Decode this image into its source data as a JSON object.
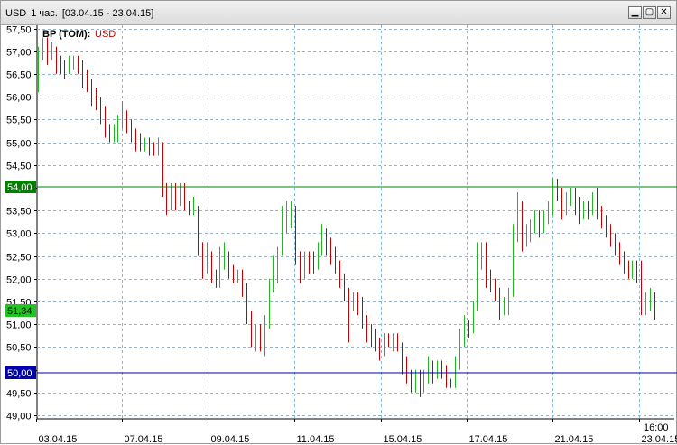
{
  "window": {
    "title_parts": [
      "USD",
      "1 час.",
      "[03.04.15 - 23.04.15]"
    ],
    "buttons": [
      {
        "name": "minimize-button",
        "icon": "minimize-icon",
        "glyph": "▁"
      },
      {
        "name": "restore-button",
        "icon": "restore-icon",
        "glyph": "▢"
      },
      {
        "name": "close-button",
        "icon": "close-icon",
        "glyph": "✕"
      }
    ]
  },
  "legend": {
    "instrument": "BP (TOM):",
    "currency": "USD"
  },
  "price_labels": {
    "green_line": "54,00",
    "current": "51,34",
    "blue_line": "50,00"
  },
  "colors": {
    "up": "#22b622",
    "down": "#c40000",
    "grid": "#8ab4d8",
    "green_line": "#008000",
    "blue_line": "#0000aa",
    "current_bg": "#22c422",
    "blue_bg": "#0000aa"
  },
  "time_label": "16:00",
  "chart_data": {
    "type": "candlestick-bars",
    "title": "BP (TOM): USD",
    "ylim": [
      49.0,
      57.5
    ],
    "y_ticks": [
      "57,50",
      "57,00",
      "56,50",
      "56,00",
      "55,50",
      "55,00",
      "54,50",
      "54,00",
      "53,50",
      "53,00",
      "52,50",
      "52,00",
      "51,50",
      "51,00",
      "50,50",
      "50,00",
      "49,50",
      "49,00"
    ],
    "x_ticks": [
      "03.04.15",
      "07.04.15",
      "09.04.15",
      "11.04.15",
      "15.04.15",
      "17.04.15",
      "21.04.15",
      "23.04.15"
    ],
    "horizontal_lines": [
      {
        "value": 54.0,
        "color": "green"
      },
      {
        "value": 50.0,
        "color": "blue"
      }
    ],
    "last_value": 51.34,
    "bars": [
      {
        "o": 56.2,
        "c": 56.9,
        "h": 57.1,
        "l": 56.1,
        "up": true
      },
      {
        "o": 56.9,
        "c": 57.1,
        "h": 57.3,
        "l": 56.8,
        "up": true
      },
      {
        "o": 57.1,
        "c": 56.9,
        "h": 57.3,
        "l": 56.7,
        "up": false
      },
      {
        "o": 56.9,
        "c": 57.0,
        "h": 57.2,
        "l": 56.8,
        "up": true
      },
      {
        "o": 57.0,
        "c": 56.8,
        "h": 57.1,
        "l": 56.5,
        "up": false
      },
      {
        "o": 56.8,
        "c": 56.7,
        "h": 56.9,
        "l": 56.5,
        "up": false
      },
      {
        "o": 56.7,
        "c": 56.6,
        "h": 56.8,
        "l": 56.4,
        "up": false
      },
      {
        "o": 56.6,
        "c": 56.7,
        "h": 56.9,
        "l": 56.5,
        "up": true
      },
      {
        "o": 56.7,
        "c": 56.8,
        "h": 56.9,
        "l": 56.6,
        "up": true
      },
      {
        "o": 56.8,
        "c": 56.7,
        "h": 56.9,
        "l": 56.5,
        "up": false
      },
      {
        "o": 56.7,
        "c": 56.5,
        "h": 56.8,
        "l": 56.2,
        "up": false
      },
      {
        "o": 56.5,
        "c": 56.3,
        "h": 56.6,
        "l": 56.1,
        "up": false
      },
      {
        "o": 56.3,
        "c": 56.1,
        "h": 56.4,
        "l": 55.8,
        "up": false
      },
      {
        "o": 56.1,
        "c": 55.9,
        "h": 56.2,
        "l": 55.7,
        "up": false
      },
      {
        "o": 55.9,
        "c": 55.6,
        "h": 56.0,
        "l": 55.4,
        "up": false
      },
      {
        "o": 55.6,
        "c": 55.2,
        "h": 55.8,
        "l": 55.1,
        "up": false
      },
      {
        "o": 55.2,
        "c": 55.1,
        "h": 55.4,
        "l": 55.0,
        "up": false
      },
      {
        "o": 55.1,
        "c": 55.2,
        "h": 55.4,
        "l": 55.0,
        "up": true
      },
      {
        "o": 55.2,
        "c": 55.4,
        "h": 55.6,
        "l": 55.0,
        "up": true
      },
      {
        "o": 55.4,
        "c": 55.6,
        "h": 55.9,
        "l": 55.3,
        "up": true
      },
      {
        "o": 55.6,
        "c": 55.4,
        "h": 55.7,
        "l": 55.2,
        "up": false
      },
      {
        "o": 55.4,
        "c": 55.2,
        "h": 55.5,
        "l": 55.0,
        "up": false
      },
      {
        "o": 55.2,
        "c": 55.0,
        "h": 55.3,
        "l": 54.8,
        "up": false
      },
      {
        "o": 55.0,
        "c": 54.9,
        "h": 55.2,
        "l": 54.8,
        "up": false
      },
      {
        "o": 54.9,
        "c": 55.0,
        "h": 55.1,
        "l": 54.8,
        "up": true
      },
      {
        "o": 55.0,
        "c": 54.9,
        "h": 55.1,
        "l": 54.7,
        "up": false
      },
      {
        "o": 54.9,
        "c": 54.8,
        "h": 55.0,
        "l": 54.7,
        "up": false
      },
      {
        "o": 54.8,
        "c": 54.9,
        "h": 55.1,
        "l": 54.7,
        "up": true
      },
      {
        "o": 54.9,
        "c": 54.0,
        "h": 55.0,
        "l": 53.8,
        "up": false
      },
      {
        "o": 54.0,
        "c": 53.6,
        "h": 54.1,
        "l": 53.4,
        "up": false
      },
      {
        "o": 53.6,
        "c": 54.0,
        "h": 54.1,
        "l": 53.5,
        "up": true
      },
      {
        "o": 54.0,
        "c": 53.7,
        "h": 54.1,
        "l": 53.5,
        "up": false
      },
      {
        "o": 53.7,
        "c": 53.9,
        "h": 54.1,
        "l": 53.6,
        "up": true
      },
      {
        "o": 53.9,
        "c": 53.6,
        "h": 54.1,
        "l": 53.5,
        "up": false
      },
      {
        "o": 53.6,
        "c": 53.5,
        "h": 53.7,
        "l": 53.4,
        "up": false
      },
      {
        "o": 53.5,
        "c": 53.6,
        "h": 53.8,
        "l": 53.4,
        "up": true
      },
      {
        "o": 53.6,
        "c": 52.7,
        "h": 53.6,
        "l": 52.5,
        "up": false
      },
      {
        "o": 52.7,
        "c": 52.2,
        "h": 52.8,
        "l": 52.0,
        "up": false
      },
      {
        "o": 52.2,
        "c": 52.4,
        "h": 52.8,
        "l": 52.1,
        "up": true
      },
      {
        "o": 52.4,
        "c": 52.1,
        "h": 52.6,
        "l": 51.9,
        "up": false
      },
      {
        "o": 52.1,
        "c": 51.9,
        "h": 52.2,
        "l": 51.8,
        "up": false
      },
      {
        "o": 51.9,
        "c": 52.3,
        "h": 52.7,
        "l": 51.8,
        "up": true
      },
      {
        "o": 52.3,
        "c": 52.5,
        "h": 52.8,
        "l": 52.2,
        "up": true
      },
      {
        "o": 52.5,
        "c": 52.2,
        "h": 52.6,
        "l": 52.0,
        "up": false
      },
      {
        "o": 52.2,
        "c": 52.0,
        "h": 52.3,
        "l": 51.9,
        "up": false
      },
      {
        "o": 52.0,
        "c": 52.1,
        "h": 52.2,
        "l": 51.9,
        "up": true
      },
      {
        "o": 52.1,
        "c": 51.8,
        "h": 52.2,
        "l": 51.6,
        "up": false
      },
      {
        "o": 51.8,
        "c": 51.2,
        "h": 51.9,
        "l": 51.0,
        "up": false
      },
      {
        "o": 51.2,
        "c": 50.6,
        "h": 51.3,
        "l": 50.5,
        "up": false
      },
      {
        "o": 50.6,
        "c": 50.8,
        "h": 51.0,
        "l": 50.4,
        "up": true
      },
      {
        "o": 50.8,
        "c": 50.5,
        "h": 51.0,
        "l": 50.4,
        "up": false
      },
      {
        "o": 50.5,
        "c": 51.0,
        "h": 51.2,
        "l": 50.3,
        "up": true
      },
      {
        "o": 51.0,
        "c": 51.8,
        "h": 52.0,
        "l": 50.9,
        "up": true
      },
      {
        "o": 51.8,
        "c": 52.2,
        "h": 52.5,
        "l": 51.7,
        "up": true
      },
      {
        "o": 52.2,
        "c": 52.6,
        "h": 52.7,
        "l": 51.9,
        "up": true
      },
      {
        "o": 52.6,
        "c": 53.2,
        "h": 53.6,
        "l": 52.5,
        "up": true
      },
      {
        "o": 53.2,
        "c": 53.4,
        "h": 53.7,
        "l": 53.0,
        "up": true
      },
      {
        "o": 53.4,
        "c": 53.6,
        "h": 53.7,
        "l": 53.1,
        "up": true
      },
      {
        "o": 53.6,
        "c": 52.5,
        "h": 53.6,
        "l": 52.3,
        "up": false
      },
      {
        "o": 52.5,
        "c": 52.1,
        "h": 52.6,
        "l": 51.9,
        "up": false
      },
      {
        "o": 52.1,
        "c": 52.5,
        "h": 52.6,
        "l": 52.0,
        "up": true
      },
      {
        "o": 52.5,
        "c": 52.4,
        "h": 52.6,
        "l": 52.1,
        "up": false
      },
      {
        "o": 52.4,
        "c": 52.3,
        "h": 52.6,
        "l": 52.1,
        "up": false
      },
      {
        "o": 52.3,
        "c": 52.6,
        "h": 52.8,
        "l": 52.2,
        "up": true
      },
      {
        "o": 52.6,
        "c": 53.0,
        "h": 53.2,
        "l": 52.5,
        "up": true
      },
      {
        "o": 53.0,
        "c": 52.7,
        "h": 53.1,
        "l": 52.5,
        "up": false
      },
      {
        "o": 52.7,
        "c": 52.5,
        "h": 52.9,
        "l": 52.3,
        "up": false
      },
      {
        "o": 52.5,
        "c": 52.3,
        "h": 52.7,
        "l": 52.1,
        "up": false
      },
      {
        "o": 52.3,
        "c": 52.0,
        "h": 52.4,
        "l": 51.8,
        "up": false
      },
      {
        "o": 52.0,
        "c": 51.7,
        "h": 52.1,
        "l": 51.5,
        "up": false
      },
      {
        "o": 51.7,
        "c": 51.5,
        "h": 51.8,
        "l": 50.6,
        "up": false
      },
      {
        "o": 51.5,
        "c": 51.6,
        "h": 51.7,
        "l": 51.3,
        "up": true
      },
      {
        "o": 51.6,
        "c": 51.4,
        "h": 51.7,
        "l": 51.2,
        "up": false
      },
      {
        "o": 51.4,
        "c": 51.1,
        "h": 51.6,
        "l": 50.9,
        "up": false
      },
      {
        "o": 51.1,
        "c": 50.8,
        "h": 51.2,
        "l": 50.6,
        "up": false
      },
      {
        "o": 50.8,
        "c": 50.7,
        "h": 51.0,
        "l": 50.5,
        "up": false
      },
      {
        "o": 50.7,
        "c": 50.6,
        "h": 50.9,
        "l": 50.4,
        "up": false
      },
      {
        "o": 50.6,
        "c": 50.4,
        "h": 50.7,
        "l": 50.2,
        "up": false
      },
      {
        "o": 50.4,
        "c": 50.7,
        "h": 50.8,
        "l": 50.3,
        "up": true
      },
      {
        "o": 50.7,
        "c": 50.6,
        "h": 50.8,
        "l": 50.5,
        "up": false
      },
      {
        "o": 50.6,
        "c": 50.7,
        "h": 50.8,
        "l": 50.4,
        "up": true
      },
      {
        "o": 50.7,
        "c": 50.5,
        "h": 50.8,
        "l": 50.4,
        "up": false
      },
      {
        "o": 50.5,
        "c": 50.2,
        "h": 50.6,
        "l": 49.9,
        "up": false
      },
      {
        "o": 50.2,
        "c": 49.9,
        "h": 50.3,
        "l": 49.7,
        "up": false
      },
      {
        "o": 49.9,
        "c": 49.7,
        "h": 50.0,
        "l": 49.5,
        "up": false
      },
      {
        "o": 49.7,
        "c": 49.8,
        "h": 50.0,
        "l": 49.5,
        "up": true
      },
      {
        "o": 49.8,
        "c": 49.6,
        "h": 50.0,
        "l": 49.4,
        "up": false
      },
      {
        "o": 49.6,
        "c": 49.8,
        "h": 50.0,
        "l": 49.5,
        "up": true
      },
      {
        "o": 49.8,
        "c": 50.1,
        "h": 50.3,
        "l": 49.7,
        "up": true
      },
      {
        "o": 50.1,
        "c": 49.9,
        "h": 50.2,
        "l": 49.7,
        "up": false
      },
      {
        "o": 49.9,
        "c": 50.1,
        "h": 50.2,
        "l": 49.8,
        "up": true
      },
      {
        "o": 50.1,
        "c": 50.0,
        "h": 50.2,
        "l": 49.8,
        "up": false
      },
      {
        "o": 50.0,
        "c": 49.7,
        "h": 50.1,
        "l": 49.6,
        "up": false
      },
      {
        "o": 49.7,
        "c": 49.7,
        "h": 49.8,
        "l": 49.6,
        "up": false
      },
      {
        "o": 49.7,
        "c": 50.1,
        "h": 50.3,
        "l": 49.6,
        "up": true
      },
      {
        "o": 50.1,
        "c": 50.7,
        "h": 50.9,
        "l": 50.0,
        "up": true
      },
      {
        "o": 50.7,
        "c": 51.0,
        "h": 51.2,
        "l": 50.5,
        "up": true
      },
      {
        "o": 51.0,
        "c": 50.9,
        "h": 51.1,
        "l": 50.7,
        "up": false
      },
      {
        "o": 50.9,
        "c": 51.4,
        "h": 51.5,
        "l": 50.8,
        "up": true
      },
      {
        "o": 51.4,
        "c": 52.4,
        "h": 52.8,
        "l": 51.3,
        "up": true
      },
      {
        "o": 52.4,
        "c": 52.7,
        "h": 52.8,
        "l": 52.2,
        "up": true
      },
      {
        "o": 52.7,
        "c": 52.0,
        "h": 52.8,
        "l": 51.8,
        "up": false
      },
      {
        "o": 52.0,
        "c": 51.9,
        "h": 52.2,
        "l": 51.7,
        "up": false
      },
      {
        "o": 51.9,
        "c": 51.7,
        "h": 52.0,
        "l": 51.5,
        "up": false
      },
      {
        "o": 51.7,
        "c": 51.3,
        "h": 51.8,
        "l": 51.1,
        "up": false
      },
      {
        "o": 51.3,
        "c": 51.4,
        "h": 51.6,
        "l": 51.2,
        "up": true
      },
      {
        "o": 51.4,
        "c": 51.7,
        "h": 51.8,
        "l": 51.2,
        "up": true
      },
      {
        "o": 51.7,
        "c": 52.9,
        "h": 53.2,
        "l": 51.6,
        "up": true
      },
      {
        "o": 52.9,
        "c": 53.6,
        "h": 53.9,
        "l": 52.8,
        "up": true
      },
      {
        "o": 53.6,
        "c": 52.8,
        "h": 53.7,
        "l": 52.6,
        "up": false
      },
      {
        "o": 52.8,
        "c": 53.0,
        "h": 53.2,
        "l": 52.7,
        "up": true
      },
      {
        "o": 53.0,
        "c": 53.2,
        "h": 53.3,
        "l": 52.8,
        "up": true
      },
      {
        "o": 53.2,
        "c": 53.4,
        "h": 53.5,
        "l": 53.0,
        "up": true
      },
      {
        "o": 53.4,
        "c": 53.1,
        "h": 53.5,
        "l": 52.9,
        "up": false
      },
      {
        "o": 53.1,
        "c": 53.4,
        "h": 53.5,
        "l": 53.0,
        "up": true
      },
      {
        "o": 53.4,
        "c": 53.6,
        "h": 53.7,
        "l": 53.2,
        "up": true
      },
      {
        "o": 53.6,
        "c": 54.1,
        "h": 54.2,
        "l": 53.4,
        "up": true
      },
      {
        "o": 54.1,
        "c": 53.9,
        "h": 54.2,
        "l": 53.7,
        "up": false
      },
      {
        "o": 53.9,
        "c": 53.5,
        "h": 54.0,
        "l": 53.3,
        "up": false
      },
      {
        "o": 53.5,
        "c": 53.8,
        "h": 53.9,
        "l": 53.4,
        "up": true
      },
      {
        "o": 53.8,
        "c": 53.9,
        "h": 54.0,
        "l": 53.6,
        "up": true
      },
      {
        "o": 53.9,
        "c": 53.6,
        "h": 54.0,
        "l": 53.4,
        "up": false
      },
      {
        "o": 53.6,
        "c": 53.4,
        "h": 53.8,
        "l": 53.2,
        "up": false
      },
      {
        "o": 53.4,
        "c": 53.6,
        "h": 53.7,
        "l": 53.3,
        "up": true
      },
      {
        "o": 53.6,
        "c": 53.5,
        "h": 53.7,
        "l": 53.3,
        "up": false
      },
      {
        "o": 53.5,
        "c": 53.8,
        "h": 53.9,
        "l": 53.4,
        "up": true
      },
      {
        "o": 53.8,
        "c": 53.5,
        "h": 54.0,
        "l": 53.3,
        "up": false
      },
      {
        "o": 53.5,
        "c": 53.3,
        "h": 53.6,
        "l": 53.1,
        "up": false
      },
      {
        "o": 53.3,
        "c": 53.1,
        "h": 53.4,
        "l": 52.9,
        "up": false
      },
      {
        "o": 53.1,
        "c": 52.9,
        "h": 53.2,
        "l": 52.7,
        "up": false
      },
      {
        "o": 52.9,
        "c": 52.7,
        "h": 53.0,
        "l": 52.5,
        "up": false
      },
      {
        "o": 52.7,
        "c": 52.5,
        "h": 52.8,
        "l": 52.3,
        "up": false
      },
      {
        "o": 52.5,
        "c": 52.3,
        "h": 52.6,
        "l": 52.1,
        "up": false
      },
      {
        "o": 52.3,
        "c": 52.2,
        "h": 52.4,
        "l": 52.0,
        "up": false
      },
      {
        "o": 52.2,
        "c": 52.3,
        "h": 52.4,
        "l": 52.0,
        "up": true
      },
      {
        "o": 52.3,
        "c": 52.1,
        "h": 52.4,
        "l": 51.9,
        "up": false
      },
      {
        "o": 52.1,
        "c": 51.3,
        "h": 52.4,
        "l": 51.2,
        "up": false
      },
      {
        "o": 51.3,
        "c": 51.5,
        "h": 51.7,
        "l": 51.2,
        "up": true
      },
      {
        "o": 51.5,
        "c": 51.7,
        "h": 51.8,
        "l": 51.3,
        "up": true
      },
      {
        "o": 51.7,
        "c": 51.34,
        "h": 51.7,
        "l": 51.1,
        "up": false
      }
    ]
  }
}
